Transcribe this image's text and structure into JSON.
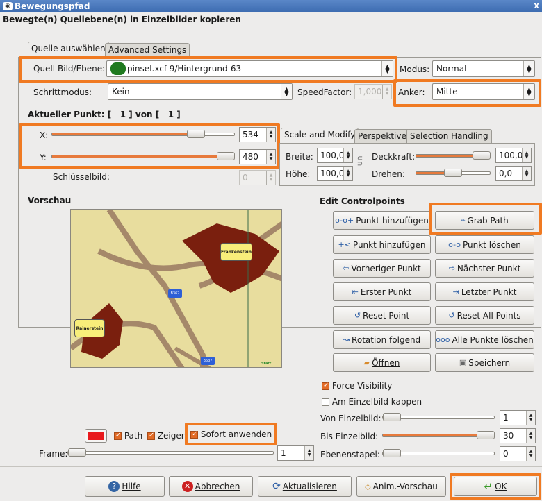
{
  "window": {
    "title": "Bewegungspfad",
    "close": "x"
  },
  "section_title": "Bewegte(n) Quellebene(n) in Einzelbilder kopieren",
  "tabs": [
    "Quelle auswählen",
    "Advanced Settings"
  ],
  "source": {
    "label": "Quell-Bild/Ebene:",
    "value": "pinsel.xcf-9/Hintergrund-63",
    "mode_label": "Modus:",
    "mode_value": "Normal",
    "step_label": "Schrittmodus:",
    "step_value": "Kein",
    "speed_label": "SpeedFactor:",
    "speed_value": "1,000",
    "anchor_label": "Anker:",
    "anchor_value": "Mitte"
  },
  "current_point": {
    "label": "Aktueller Punkt: [   1 ] von [   1 ]",
    "x_label": "X:",
    "x_value": "534",
    "x_level": 0.82,
    "y_label": "Y:",
    "y_value": "480",
    "y_level": 1.0,
    "keyframe_label": "Schlüsselbild:",
    "keyframe_value": "0"
  },
  "subtabs": [
    "Scale and Modify",
    "Perspektive",
    "Selection Handling"
  ],
  "scale": {
    "width_label": "Breite:",
    "width_value": "100,0",
    "height_label": "Höhe:",
    "height_value": "100,0",
    "opacity_label": "Deckkraft:",
    "opacity_value": "100,0",
    "opacity_level": 1.0,
    "rotate_label": "Drehen:",
    "rotate_value": "0,0",
    "rotate_level": 0.5
  },
  "preview": {
    "label": "Vorschau",
    "map_labels": [
      "Frankenstein",
      "Rainerstein",
      "B362",
      "B637",
      "Start"
    ]
  },
  "edit": {
    "label": "Edit Controlpoints",
    "buttons": [
      "Punkt hinzufügen",
      "Grab Path",
      "Punkt hinzufügen",
      "Punkt löschen",
      "Vorheriger Punkt",
      "Nächster Punkt",
      "Erster Punkt",
      "Letzter Punkt",
      "Reset Point",
      "Reset All Points",
      "Rotation folgend",
      "Alle Punkte löschen",
      "Öffnen",
      "Speichern"
    ]
  },
  "options": {
    "force_visibility": "Force Visibility",
    "clip": "Am Einzelbild kappen",
    "from_label": "Von Einzelbild:",
    "from_value": "1",
    "to_label": "Bis Einzelbild:",
    "to_value": "30",
    "stack_label": "Ebenenstapel:",
    "stack_value": "0"
  },
  "preview_controls": {
    "path": "Path",
    "pointer": "Zeiger",
    "apply": "Sofort anwenden",
    "frame_label": "Frame:",
    "frame_value": "1",
    "color": "#e8191d"
  },
  "footer": {
    "help": "Hilfe",
    "cancel": "Abbrechen",
    "refresh": "Aktualisieren",
    "anim_preview": "Anim.-Vorschau",
    "ok": "OK"
  },
  "colors": {
    "highlight": "#f07a22",
    "accent": "#e77a3c",
    "titlebar": "#4a78bd"
  }
}
